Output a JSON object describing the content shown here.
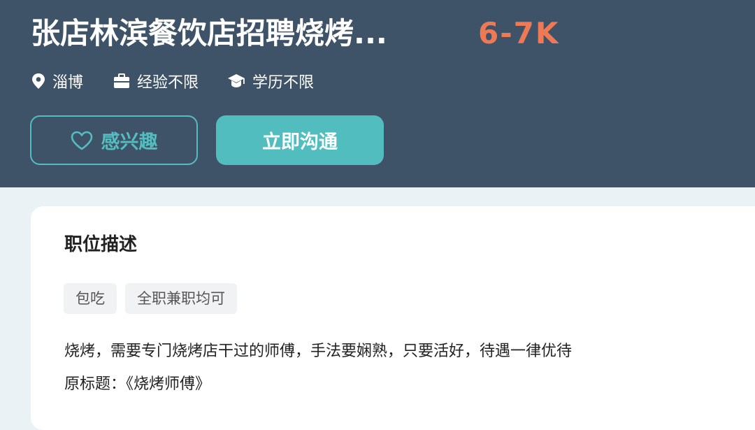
{
  "header": {
    "title": "张店林滨餐饮店招聘烧烤...",
    "salary": "6-7K",
    "meta": {
      "location": "淄博",
      "experience": "经验不限",
      "education": "学历不限"
    },
    "icons": {
      "location": "location-pin-icon",
      "experience": "briefcase-icon",
      "education": "graduation-cap-icon",
      "interest": "heart-icon"
    },
    "buttons": {
      "interest": "感兴趣",
      "chat": "立即沟通"
    }
  },
  "description": {
    "heading": "职位描述",
    "tags": [
      "包吃",
      "全职兼职均可"
    ],
    "lines": [
      "烧烤，需要专门烧烤店干过的师傅，手法要娴熟，只要活好，待遇一律优待",
      "原标题：《烧烤师傅》"
    ]
  },
  "colors": {
    "header_bg": "#3f5368",
    "salary": "#ee7a55",
    "accent": "#53bdbf",
    "page_bg": "#ebf2f5"
  }
}
